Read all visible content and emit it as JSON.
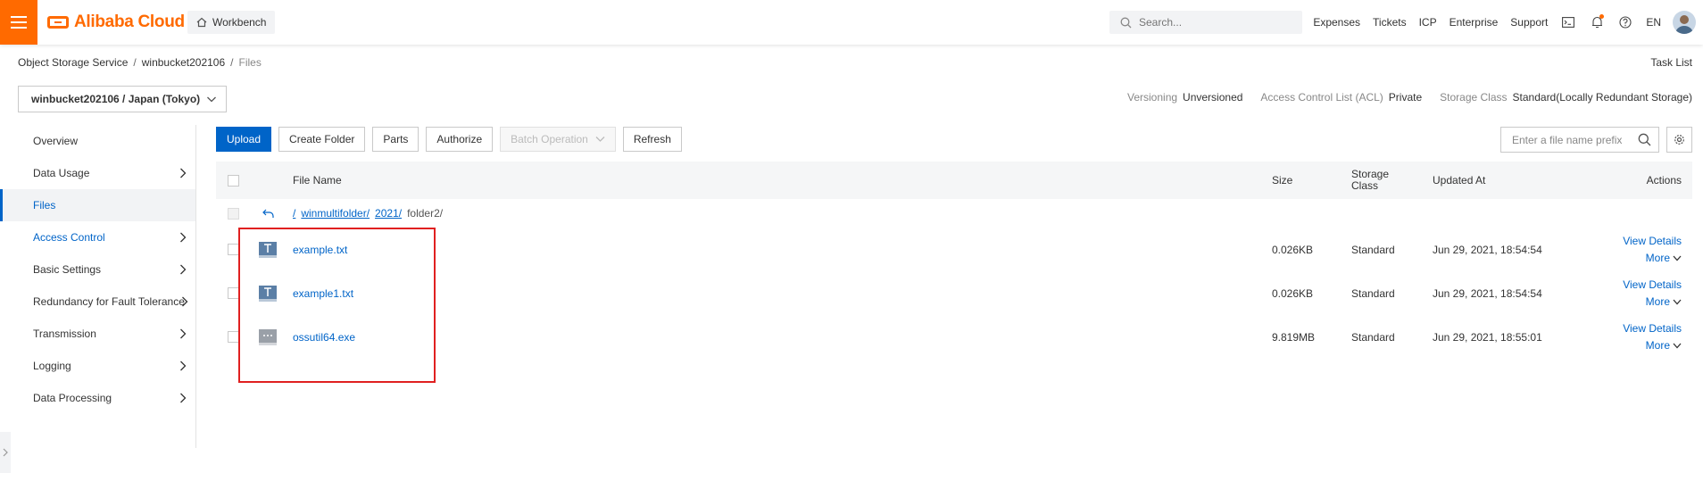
{
  "header": {
    "logo_text": "Alibaba Cloud",
    "workbench_label": "Workbench",
    "search_placeholder": "Search...",
    "nav": [
      "Expenses",
      "Tickets",
      "ICP",
      "Enterprise",
      "Support"
    ],
    "language": "EN",
    "brand_color": "#ff6a00"
  },
  "breadcrumb": {
    "items": [
      "Object Storage Service",
      "winbucket202106",
      "Files"
    ],
    "task_list": "Task List"
  },
  "bucket": {
    "selector": "winbucket202106 / Japan (Tokyo)",
    "info": [
      {
        "label": "Versioning",
        "value": "Unversioned"
      },
      {
        "label": "Access Control List (ACL)",
        "value": "Private"
      },
      {
        "label": "Storage Class",
        "value": "Standard(Locally Redundant Storage)"
      }
    ]
  },
  "sidebar": {
    "items": [
      {
        "label": "Overview",
        "has_children": false
      },
      {
        "label": "Data Usage",
        "has_children": true
      },
      {
        "label": "Files",
        "has_children": false,
        "active": true
      },
      {
        "label": "Access Control",
        "has_children": true
      },
      {
        "label": "Basic Settings",
        "has_children": true
      },
      {
        "label": "Redundancy for Fault Tolerance",
        "has_children": true
      },
      {
        "label": "Transmission",
        "has_children": true
      },
      {
        "label": "Logging",
        "has_children": true
      },
      {
        "label": "Data Processing",
        "has_children": true
      }
    ]
  },
  "toolbar": {
    "upload": "Upload",
    "create_folder": "Create Folder",
    "parts": "Parts",
    "authorize": "Authorize",
    "batch_operation": "Batch Operation",
    "refresh": "Refresh",
    "file_search_placeholder": "Enter a file name prefix"
  },
  "table": {
    "columns": {
      "file_name": "File Name",
      "size": "Size",
      "storage_class": "Storage Class",
      "updated_at": "Updated At",
      "actions": "Actions"
    },
    "path": {
      "root": "/",
      "segments": [
        "winmultifolder/",
        "2021/"
      ],
      "current": "folder2/"
    },
    "rows": [
      {
        "name": "example.txt",
        "icon": "text-file-icon",
        "size": "0.026KB",
        "storage_class": "Standard",
        "updated_at": "Jun 29, 2021, 18:54:54"
      },
      {
        "name": "example1.txt",
        "icon": "text-file-icon",
        "size": "0.026KB",
        "storage_class": "Standard",
        "updated_at": "Jun 29, 2021, 18:54:54"
      },
      {
        "name": "ossutil64.exe",
        "icon": "executable-file-icon",
        "size": "9.819MB",
        "storage_class": "Standard",
        "updated_at": "Jun 29, 2021, 18:55:01"
      }
    ],
    "action_labels": {
      "view_details": "View Details",
      "more": "More"
    }
  },
  "colors": {
    "link": "#0064c8",
    "highlight": "#e02020"
  }
}
